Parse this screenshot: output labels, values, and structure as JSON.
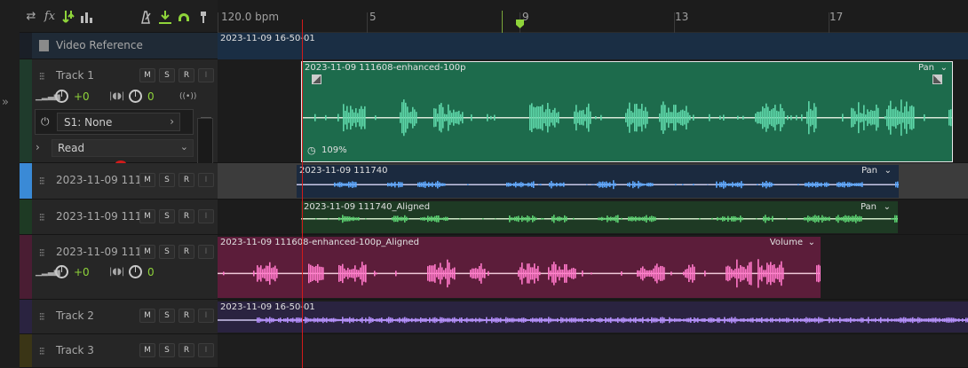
{
  "toolbar": {
    "icons": [
      "swap-icon",
      "fx-icon",
      "sends-icon",
      "meter-icon",
      "metronome-icon",
      "snap-icon",
      "loop-icon",
      "marker-pin-icon"
    ],
    "fx_label": "fx"
  },
  "ruler": {
    "bpm": "120.0 bpm",
    "ticks": [
      "5",
      "9",
      "13",
      "17"
    ]
  },
  "tracks": [
    {
      "id": "video",
      "name": "Video Reference",
      "clip": "2023-11-09 16-50-01"
    },
    {
      "id": "track1",
      "name": "Track 1",
      "buttons": [
        "M",
        "S",
        "R",
        "I"
      ],
      "volume": "+0",
      "pan": "0",
      "send": "S1: None",
      "automation": "Read",
      "clip": "2023-11-09 111608-enhanced-100p",
      "clip_param": "Pan",
      "clip_speed": "109%"
    },
    {
      "id": "t3",
      "name": "2023-11-09 111",
      "buttons": [
        "M",
        "S",
        "R",
        "I"
      ],
      "clip": "2023-11-09 111740",
      "clip_param": "Pan"
    },
    {
      "id": "t4",
      "name": "2023-11-09 111",
      "buttons": [
        "M",
        "S",
        "R",
        "I"
      ],
      "clip": "2023-11-09 111740_Aligned",
      "clip_param": "Pan"
    },
    {
      "id": "t5",
      "name": "2023-11-09 111",
      "buttons": [
        "M",
        "S",
        "R",
        "I"
      ],
      "volume": "+0",
      "pan": "0",
      "clip": "2023-11-09 111608-enhanced-100p_Aligned",
      "clip_param": "Volume"
    },
    {
      "id": "track2",
      "name": "Track 2",
      "buttons": [
        "M",
        "S",
        "R",
        "I"
      ],
      "clip": "2023-11-09 16-50-01"
    },
    {
      "id": "track3",
      "name": "Track 3",
      "buttons": [
        "M",
        "S",
        "R",
        "I"
      ]
    }
  ],
  "colors": {
    "accent_green": "#8fd43a",
    "playhead": "#d11b1b",
    "track1_clip": "#1d6b4c",
    "t3_clip": "#1b2a3f",
    "t4_clip": "#1e3a24",
    "t5_clip": "#5c1d3a",
    "track2_clip": "#2a2340",
    "video_clip": "#1a2e44"
  }
}
